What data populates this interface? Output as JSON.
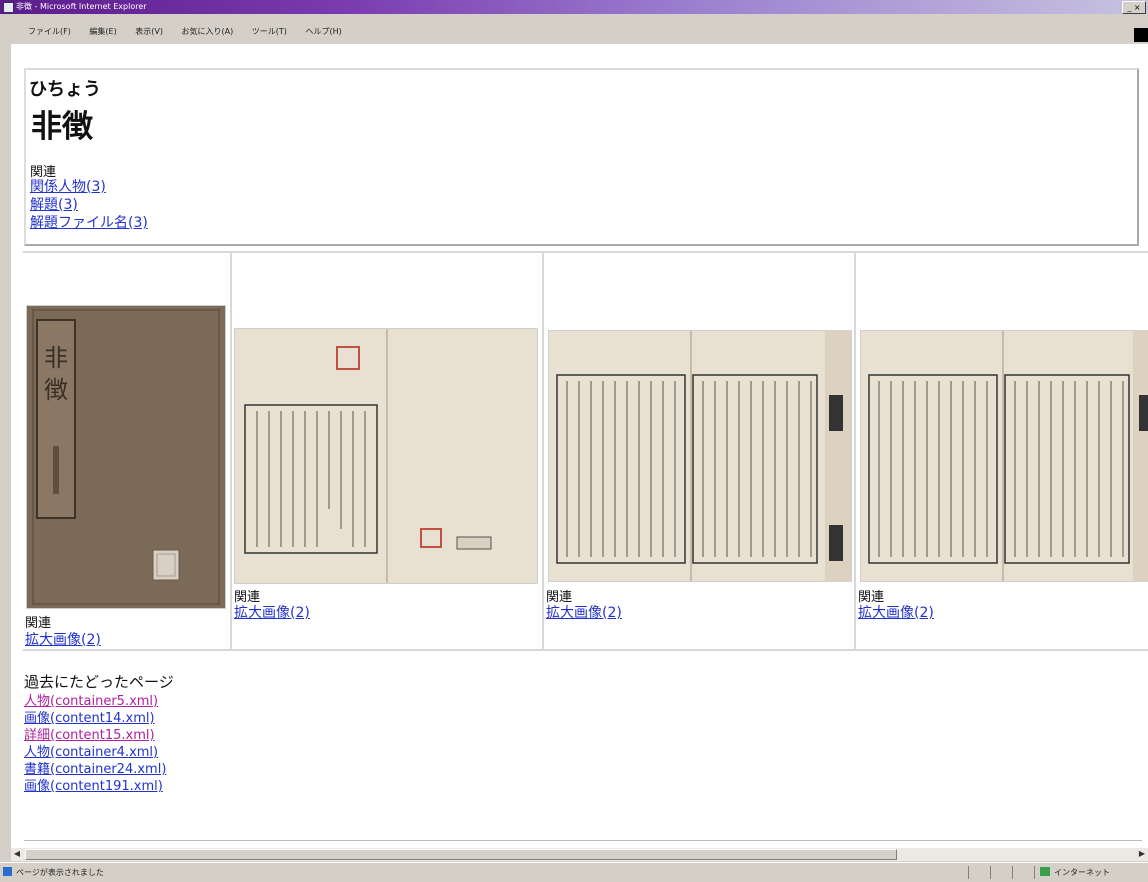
{
  "window": {
    "title": "非徴 - Microsoft Internet Explorer",
    "controls": "_ ×"
  },
  "menu": {
    "items": [
      "ファイル(F)",
      "編集(E)",
      "表示(V)",
      "お気に入り(A)",
      "ツール(T)",
      "ヘルプ(H)"
    ]
  },
  "page": {
    "reading": "ひちょう",
    "title": "非徴",
    "related_heading": "関連",
    "related_links": [
      "関係人物(3)",
      "解題(3)",
      "解題ファイル名(3)"
    ],
    "images": [
      {
        "related": "関連",
        "link": "拡大画像(2)",
        "kind": "cover"
      },
      {
        "related": "関連",
        "link": "拡大画像(2)",
        "kind": "spread-first"
      },
      {
        "related": "関連",
        "link": "拡大画像(2)",
        "kind": "spread"
      },
      {
        "related": "関連",
        "link": "拡大画像(2)",
        "kind": "spread"
      }
    ],
    "history_heading": "過去にたどったページ",
    "history_links": [
      {
        "label": "人物(container5.xml)",
        "visited": true
      },
      {
        "label": "画像(content14.xml)",
        "visited": false
      },
      {
        "label": "詳細(content15.xml)",
        "visited": true
      },
      {
        "label": "人物(container4.xml)",
        "visited": false
      },
      {
        "label": "書籍(container24.xml)",
        "visited": false
      },
      {
        "label": "画像(content191.xml)",
        "visited": false
      }
    ]
  },
  "status": {
    "text": "ページが表示されました",
    "zone": "インターネット"
  },
  "colors": {
    "link": "#2233cc",
    "visited_link": "#b020a0",
    "titlebar_start": "#5c1c8c",
    "cover": "#7b6a58",
    "paper": "#e8e0d0"
  }
}
